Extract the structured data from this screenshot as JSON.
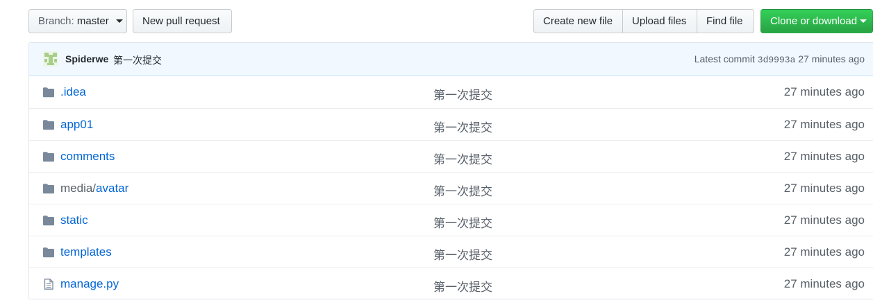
{
  "toolbar": {
    "branch_prefix": "Branch:",
    "branch_value": "master",
    "new_pull_request": "New pull request",
    "create_new_file": "Create new file",
    "upload_files": "Upload files",
    "find_file": "Find file",
    "clone_or_download": "Clone or download"
  },
  "commit": {
    "author": "Spiderwe",
    "message": "第一次提交",
    "latest_label": "Latest commit",
    "sha": "3d9993a",
    "age": "27 minutes ago"
  },
  "files": [
    {
      "type": "folder",
      "dir_prefix": "",
      "name": ".idea",
      "message": "第一次提交",
      "age": "27 minutes ago"
    },
    {
      "type": "folder",
      "dir_prefix": "",
      "name": "app01",
      "message": "第一次提交",
      "age": "27 minutes ago"
    },
    {
      "type": "folder",
      "dir_prefix": "",
      "name": "comments",
      "message": "第一次提交",
      "age": "27 minutes ago"
    },
    {
      "type": "folder",
      "dir_prefix": "media/",
      "name": "avatar",
      "message": "第一次提交",
      "age": "27 minutes ago"
    },
    {
      "type": "folder",
      "dir_prefix": "",
      "name": "static",
      "message": "第一次提交",
      "age": "27 minutes ago"
    },
    {
      "type": "folder",
      "dir_prefix": "",
      "name": "templates",
      "message": "第一次提交",
      "age": "27 minutes ago"
    },
    {
      "type": "file",
      "dir_prefix": "",
      "name": "manage.py",
      "message": "第一次提交",
      "age": "27 minutes ago"
    }
  ],
  "colors": {
    "link": "#0366d6",
    "muted": "#586069",
    "icon": "#79889b",
    "clone_green": "#2cbe4e",
    "commit_bar_bg": "#f1f8ff"
  }
}
